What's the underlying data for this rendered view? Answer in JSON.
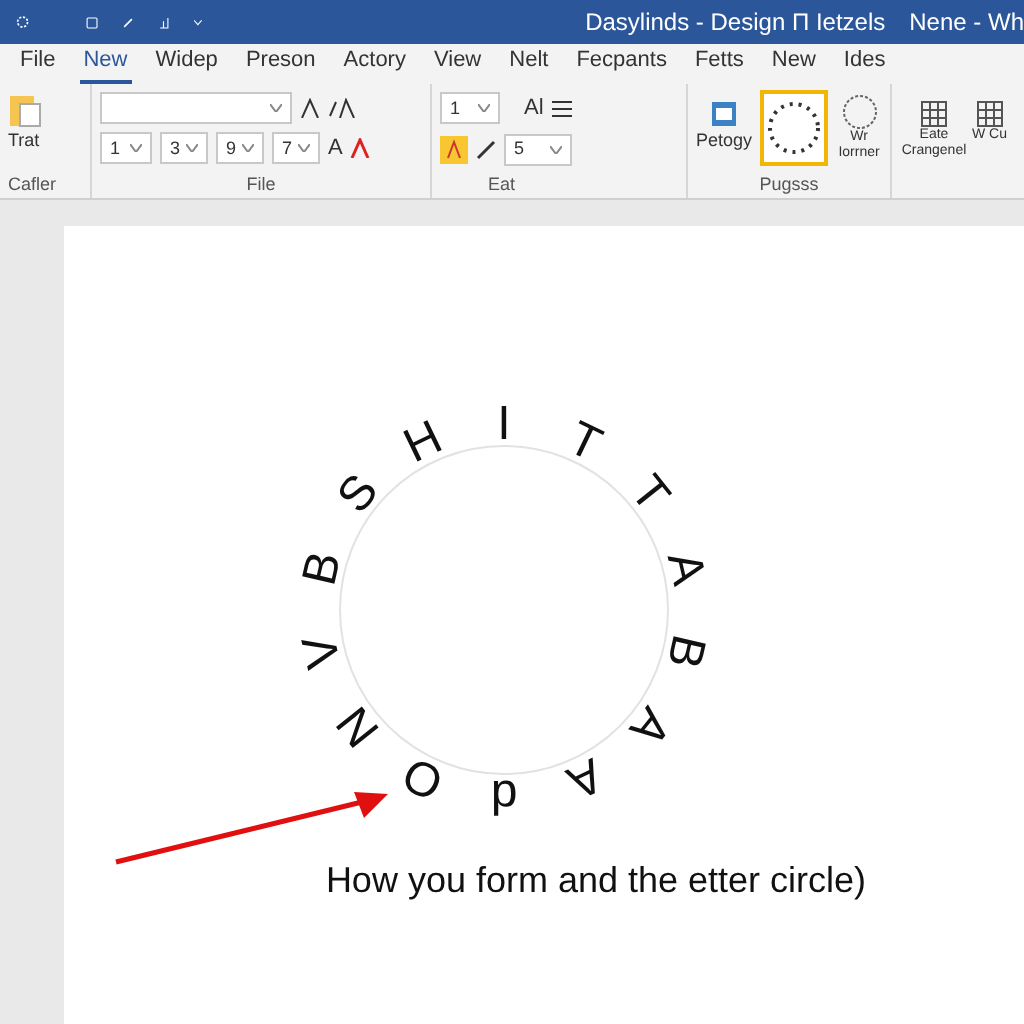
{
  "window": {
    "title": "Dasylinds - Design Π Ietzels",
    "title_right": "Nene - Wh"
  },
  "tabs": [
    {
      "label": "File",
      "selected": false
    },
    {
      "label": "New",
      "selected": true
    },
    {
      "label": "Widep",
      "selected": false
    },
    {
      "label": "Preson",
      "selected": false
    },
    {
      "label": "Actory",
      "selected": false
    },
    {
      "label": "View",
      "selected": false
    },
    {
      "label": "Nelt",
      "selected": false
    },
    {
      "label": "Fecpants",
      "selected": false
    },
    {
      "label": "Fetts",
      "selected": false
    },
    {
      "label": "New",
      "selected": false
    },
    {
      "label": "Ides",
      "selected": false
    }
  ],
  "ribbon": {
    "clipboard": {
      "button": "Trat",
      "group": "Cafler"
    },
    "font": {
      "group": "File",
      "row2_values": [
        "1",
        "3",
        "9",
        "7"
      ],
      "font_size_letter": "A"
    },
    "paragraph": {
      "group": "Eat",
      "values": [
        "1",
        "5"
      ],
      "label": "Al"
    },
    "styles": {
      "group": "Pugsss",
      "items": [
        {
          "label": "Petogy",
          "selected": false
        },
        {
          "label": "Wr Iorrner",
          "selected": false
        }
      ],
      "gallery_selected": true
    },
    "more": {
      "items": [
        {
          "label": "Eate Crangenel"
        },
        {
          "label": "W Cu"
        }
      ]
    }
  },
  "document": {
    "ring_letters": [
      "I",
      "T",
      "T",
      "A",
      "B",
      "A",
      "A",
      "d",
      "O",
      "N",
      "V",
      "B",
      "S",
      "H"
    ],
    "caption": "How you form and the etter circle)"
  }
}
